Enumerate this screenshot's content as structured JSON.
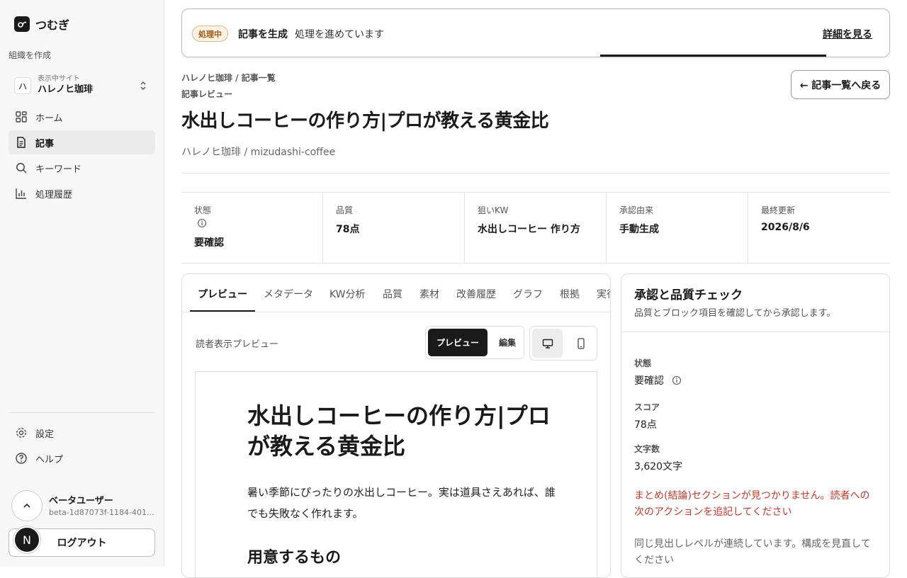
{
  "brand": {
    "name": "つむぎ",
    "logo_icon": "thread-logo-icon"
  },
  "sidebar": {
    "org_label": "組織を作成",
    "site": {
      "avatar": "ハ",
      "caption": "表示中サイト",
      "name": "ハレノヒ珈琲"
    },
    "items": [
      {
        "label": "ホーム",
        "icon": "grid-icon"
      },
      {
        "label": "記事",
        "icon": "document-icon",
        "active": true
      },
      {
        "label": "キーワード",
        "icon": "search-icon"
      },
      {
        "label": "処理履歴",
        "icon": "bar-chart-icon"
      }
    ],
    "bottom_items": [
      {
        "label": "設定",
        "icon": "gear-icon"
      },
      {
        "label": "ヘルプ",
        "icon": "help-icon"
      }
    ],
    "user": {
      "name": "ベータユーザー",
      "id": "beta-1d87073f-1184-401..."
    },
    "logout": "ログアウト",
    "n_badge": "N"
  },
  "banner": {
    "status": "処理中",
    "title": "記事を生成",
    "message": "処理を進めています",
    "link": "詳細を見る",
    "accent": "#9a5a10"
  },
  "header": {
    "breadcrumb": "ハレノヒ珈琲 / 記事一覧",
    "section": "記事レビュー",
    "title": "水出しコーヒーの作り方|プロが教える黄金比",
    "subtitle": "ハレノヒ珈琲 / mizudashi-coffee",
    "back_button": "← 記事一覧へ戻る"
  },
  "stats": [
    {
      "label": "状態",
      "value": "要確認",
      "info": true
    },
    {
      "label": "品質",
      "value": "78点"
    },
    {
      "label": "狙いKW",
      "value": "水出しコーヒー 作り方"
    },
    {
      "label": "承認由来",
      "value": "手動生成"
    },
    {
      "label": "最終更新",
      "value": "2026/8/6"
    }
  ],
  "tabs": [
    "プレビュー",
    "メタデータ",
    "KW分析",
    "品質",
    "素材",
    "改善履歴",
    "グラフ",
    "根拠",
    "実行"
  ],
  "preview": {
    "label": "読者表示プレビュー",
    "mode_preview": "プレビュー",
    "mode_edit": "編集",
    "desktop_icon": "desktop-icon",
    "mobile_icon": "mobile-icon",
    "article": {
      "title": "水出しコーヒーの作り方|プロが教える黄金比",
      "intro": "暑い季節にぴったりの水出しコーヒー。実は道具さえあれば、誰でも失敗なく作れます。",
      "h2": "用意するもの"
    }
  },
  "review": {
    "title": "承認と品質チェック",
    "subtitle": "品質とブロック項目を確認してから承認します。",
    "status_label": "状態",
    "status_value": "要確認",
    "score_label": "スコア",
    "score_value": "78点",
    "chars_label": "文字数",
    "chars_value": "3,620文字",
    "warning": "まとめ(結論)セクションが見つかりません。読者への次のアクションを追記してください",
    "note": "同じ見出しレベルが連続しています。構成を見直してください",
    "warning_color": "#c0392b"
  }
}
